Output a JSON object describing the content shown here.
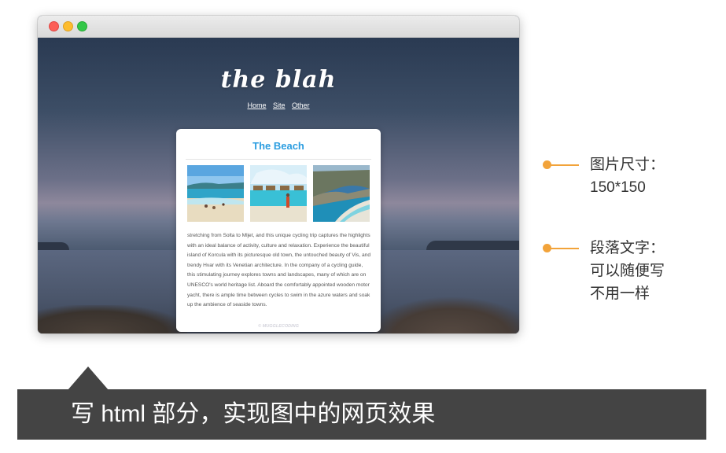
{
  "window": {
    "controls": [
      "close-button",
      "minimize-button",
      "maximize-button"
    ]
  },
  "site": {
    "logo": "the blah",
    "nav": [
      "Home",
      "Site",
      "Other"
    ],
    "card": {
      "title": "The Beach",
      "images": [
        "beach-photo-1",
        "beach-photo-2",
        "beach-photo-3"
      ],
      "paragraph": "stretching from Solta to Mljet, and this unique cycling trip captures the highlights with an ideal balance of activity, culture and relaxation. Experience the beautiful island of Korcula with its picturesque old town, the untouched beauty of Vis, and trendy Hvar with its Venetian architecture. In the company of a cycling guide, this stimulating journey explores towns and landscapes, many of which are on UNESCO's world heritage list. Aboard the comfortably appointed wooden motor yacht, there is ample time between cycles to swim in the azure waters and soak up the ambience of seaside towns."
    },
    "footer": "© MUGGLECODING"
  },
  "annotations": [
    {
      "lines": [
        "图片尺寸：",
        "150*150"
      ]
    },
    {
      "lines": [
        "段落文字：",
        "可以随便写",
        "不用一样"
      ]
    }
  ],
  "caption": "写 html 部分，实现图中的网页效果",
  "colors": {
    "accent": "#f2a33a",
    "title_blue": "#2b9de0",
    "caption_bg": "#444444"
  }
}
